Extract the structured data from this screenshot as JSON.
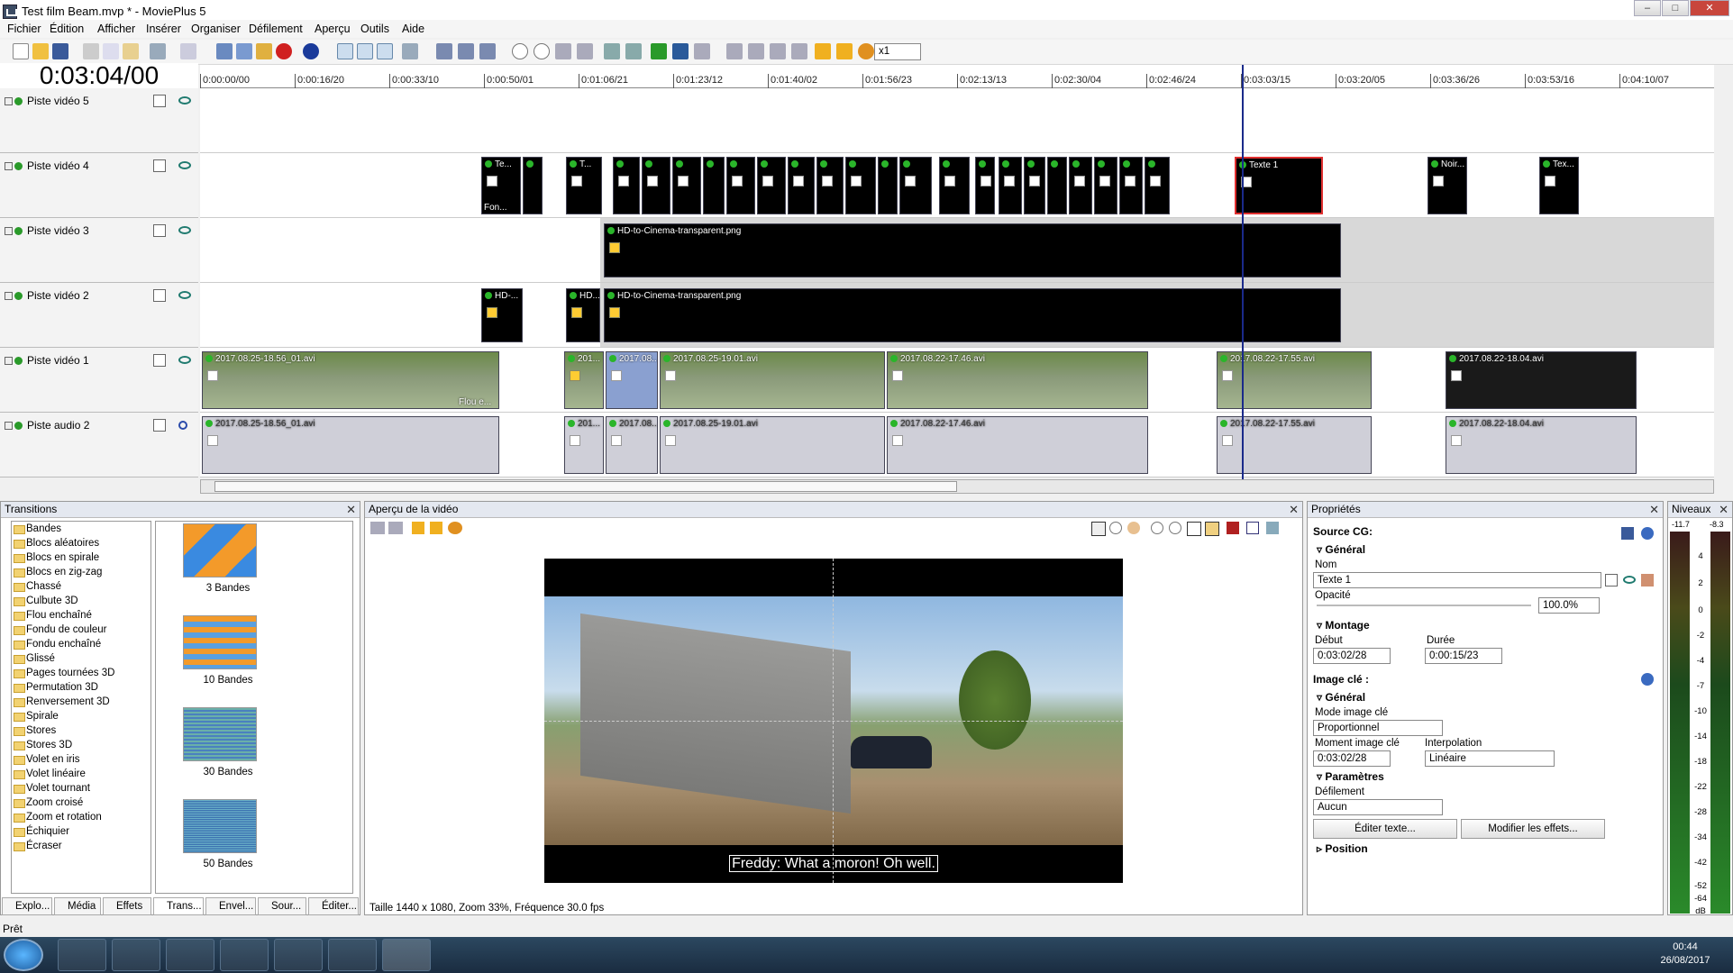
{
  "window": {
    "title": "Test film Beam.mvp * - MoviePlus 5",
    "min": "–",
    "max": "□",
    "close": "✕"
  },
  "menu": [
    "Fichier",
    "Édition",
    "Afficher",
    "Insérer",
    "Organiser",
    "Défilement",
    "Aperçu",
    "Outils",
    "Aide"
  ],
  "toolbar": {
    "speed": "x1"
  },
  "timeline": {
    "timecode": "0:03:04/00",
    "ruler": [
      "0:00:00/00",
      "0:00:16/20",
      "0:00:33/10",
      "0:00:50/01",
      "0:01:06/21",
      "0:01:23/12",
      "0:01:40/02",
      "0:01:56/23",
      "0:02:13/13",
      "0:02:30/04",
      "0:02:46/24",
      "0:03:03/15",
      "0:03:20/05",
      "0:03:36/26",
      "0:03:53/16",
      "0:04:10/07"
    ],
    "tracks": [
      "Piste vidéo 5",
      "Piste vidéo 4",
      "Piste vidéo 3",
      "Piste vidéo 2",
      "Piste vidéo 1",
      "Piste audio 2"
    ],
    "clips": {
      "t4_a": "Te...",
      "t4_a2": "Fon...",
      "t4_b": "T...",
      "t4_sel": "Texte 1",
      "t4_noir": "Noir...",
      "t4_tex": "Tex...",
      "t3_png": "HD-to-Cinema-transparent.png",
      "t2_a": "HD-...",
      "t2_b": "HD...",
      "t2_png": "HD-to-Cinema-transparent.png",
      "v1_a": "2017.08.25-18.56_01.avi",
      "v1_a_flou": "Flou e...",
      "v1_b": "201...",
      "v1_c": "2017.08...",
      "v1_d": "2017.08.25-19.01.avi",
      "v1_e": "2017.08.22-17.46.avi",
      "v1_f": "2017.08.22-17.55.avi",
      "v1_g": "2017.08.22-18.04.avi",
      "a2_a": "2017.08.25-18.56_01.avi",
      "a2_b": "201...",
      "a2_c": "2017.08...",
      "a2_d": "2017.08.25-19.01.avi",
      "a2_e": "2017.08.22-17.46.avi",
      "a2_f": "2017.08.22-17.55.avi",
      "a2_g": "2017.08.22-18.04.avi"
    }
  },
  "transitions": {
    "title": "Transitions",
    "items": [
      "Bandes",
      "Blocs aléatoires",
      "Blocs en spirale",
      "Blocs en zig-zag",
      "Chassé",
      "Culbute 3D",
      "Flou enchaîné",
      "Fondu de couleur",
      "Fondu enchaîné",
      "Glissé",
      "Pages tournées 3D",
      "Permutation 3D",
      "Renversement 3D",
      "Spirale",
      "Stores",
      "Stores 3D",
      "Volet en iris",
      "Volet linéaire",
      "Volet tournant",
      "Zoom croisé",
      "Zoom et rotation",
      "Échiquier",
      "Écraser"
    ],
    "thumbs": [
      "3 Bandes",
      "10 Bandes",
      "30 Bandes",
      "50 Bandes"
    ],
    "tabs": [
      "Explo...",
      "Média",
      "Effets",
      "Trans...",
      "Envel...",
      "Sour...",
      "Éditer..."
    ]
  },
  "preview": {
    "title": "Aperçu de la vidéo",
    "subtitle": "Freddy: What a moron! Oh well.",
    "info": "Taille 1440 x 1080, Zoom 33%, Fréquence 30.0 fps"
  },
  "properties": {
    "title": "Propriétés",
    "source": "Source CG:",
    "general": "Général",
    "nom_label": "Nom",
    "nom_value": "Texte 1",
    "opacite_label": "Opacité",
    "opacite_value": "100.0%",
    "montage": "Montage",
    "debut_label": "Début",
    "debut_value": "0:03:02/28",
    "duree_label": "Durée",
    "duree_value": "0:00:15/23",
    "image_cle": "Image clé :",
    "general2": "Général",
    "mode_label": "Mode image clé",
    "mode_value": "Proportionnel",
    "moment_label": "Moment image clé",
    "moment_value": "0:03:02/28",
    "interp_label": "Interpolation",
    "interp_value": "Linéaire",
    "parametres": "Paramètres",
    "defil_label": "Défilement",
    "defil_value": "Aucun",
    "edit_btn": "Éditer texte...",
    "effects_btn": "Modifier les effets...",
    "position": "Position"
  },
  "levels": {
    "title": "Niveaux",
    "peak_l": "-11.7",
    "peak_r": "-8.3",
    "scale": [
      "4",
      "2",
      "0",
      "-2",
      "-4",
      "-7",
      "-10",
      "-14",
      "-18",
      "-22",
      "-28",
      "-34",
      "-42",
      "-52",
      "-64",
      "dB"
    ]
  },
  "status": {
    "text": "Prêt"
  },
  "taskbar": {
    "time": "00:44",
    "date": "26/08/2017"
  },
  "colors": {
    "accent": "#2ab52a",
    "selection": "#e03030",
    "playhead": "#1a2a8a"
  }
}
